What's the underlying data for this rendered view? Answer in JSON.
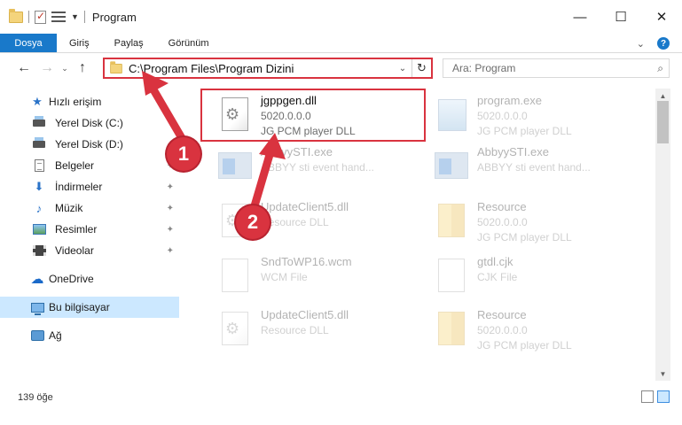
{
  "window": {
    "title": "Program",
    "controls": {
      "minimize": "—",
      "maximize": "☐",
      "close": "✕"
    }
  },
  "ribbon": {
    "tabs": [
      "Dosya",
      "Giriş",
      "Paylaş",
      "Görünüm"
    ],
    "collapse_glyph": "⌄",
    "help_glyph": "?"
  },
  "address": {
    "path": "C:\\Program Files\\Program Dizini",
    "search_placeholder": "Ara: Program",
    "refresh_glyph": "↻",
    "dropdown_glyph": "⌄"
  },
  "nav": {
    "back": "←",
    "forward": "→",
    "recent": "⌄",
    "up": "↑"
  },
  "sidebar": {
    "items": [
      {
        "label": "Hızlı erişim",
        "icon": "star-icon",
        "glyph": "★",
        "color": "#2a73c8"
      },
      {
        "label": "Yerel Disk (C:)",
        "icon": "drive-icon",
        "pinned": true
      },
      {
        "label": "Yerel Disk (D:)",
        "icon": "drive-icon",
        "pinned": true
      },
      {
        "label": "Belgeler",
        "icon": "documents-icon",
        "pinned": true
      },
      {
        "label": "İndirmeler",
        "icon": "downloads-icon",
        "glyph": "⬇",
        "color": "#2a73c8",
        "pinned": true
      },
      {
        "label": "Müzik",
        "icon": "music-icon",
        "glyph": "♪",
        "color": "#2a73c8",
        "pinned": true
      },
      {
        "label": "Resimler",
        "icon": "pictures-icon",
        "pinned": true
      },
      {
        "label": "Videolar",
        "icon": "videos-icon",
        "pinned": true
      },
      {
        "label": "OneDrive",
        "icon": "cloud-icon",
        "glyph": "☁",
        "color": "#1b6ac9"
      },
      {
        "label": "Bu bilgisayar",
        "icon": "computer-icon",
        "selected": true
      },
      {
        "label": "Ağ",
        "icon": "network-icon"
      }
    ],
    "pin_glyph": "📌"
  },
  "files": [
    {
      "name": "jgppgen.dll",
      "line2": "5020.0.0.0",
      "line3": "JG PCM player DLL",
      "kind": "dll",
      "highlight": true
    },
    {
      "name": "program.exe",
      "line2": "5020.0.0.0",
      "line3": "JG PCM player DLL",
      "kind": "program"
    },
    {
      "name": "AbbyySTI.exe",
      "line2": "ABBYY sti event hand...",
      "line3": "",
      "kind": "exe"
    },
    {
      "name": "AbbyySTI.exe",
      "line2": "ABBYY sti event hand...",
      "line3": "",
      "kind": "exe"
    },
    {
      "name": "UpdateClient5.dll",
      "line2": "Resource DLL",
      "line3": "",
      "kind": "dll"
    },
    {
      "name": "Resource",
      "line2": "5020.0.0.0",
      "line3": "JG PCM player DLL",
      "kind": "resource"
    },
    {
      "name": "SndToWP16.wcm",
      "line2": "WCM File",
      "line3": "",
      "kind": "file"
    },
    {
      "name": "gtdl.cjk",
      "line2": "CJK File",
      "line3": "",
      "kind": "file"
    },
    {
      "name": "UpdateClient5.dll",
      "line2": "Resource DLL",
      "line3": "",
      "kind": "dll"
    },
    {
      "name": "Resource",
      "line2": "5020.0.0.0",
      "line3": "JG PCM player DLL",
      "kind": "resource"
    }
  ],
  "status": {
    "count_text": "139 öğe"
  },
  "scrollbar": {
    "up": "▲",
    "down": "▼"
  },
  "annotations": {
    "badge1": "1",
    "badge2": "2",
    "color": "#d9333f"
  }
}
